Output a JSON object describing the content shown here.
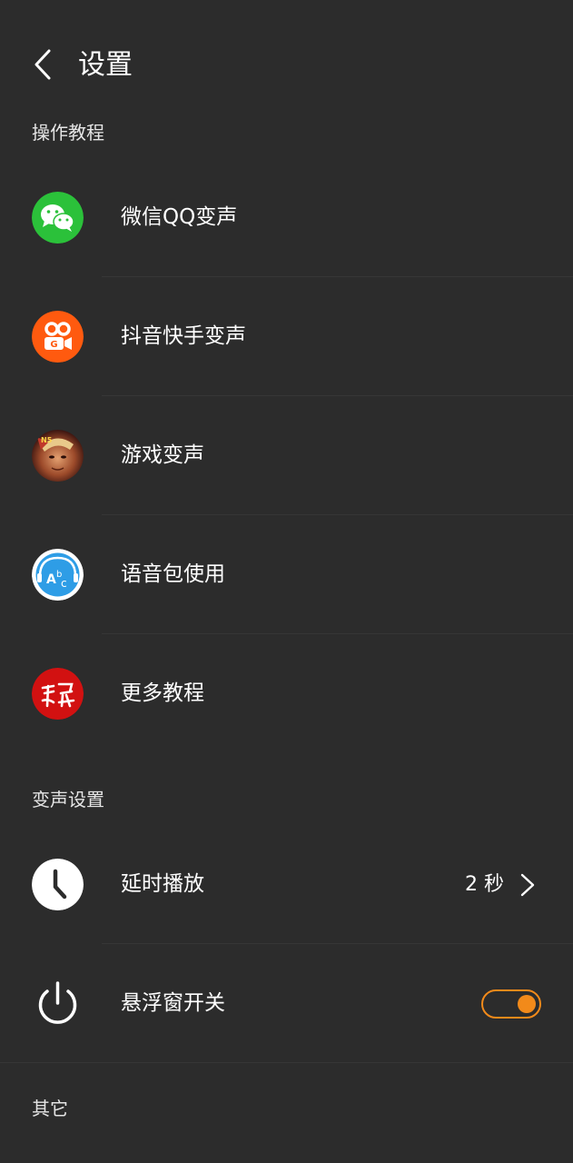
{
  "header": {
    "title": "设置",
    "back_icon": "chevron-left-icon"
  },
  "sections": {
    "tutorials": {
      "label": "操作教程"
    },
    "voice_settings": {
      "label": "变声设置"
    },
    "other": {
      "label": "其它"
    }
  },
  "tutorials": [
    {
      "label": "微信QQ变声",
      "icon": "wechat-icon",
      "icon_color": "#2bc13a"
    },
    {
      "label": "抖音快手变声",
      "icon": "kuaishou-icon",
      "icon_color": "#ff5a0f"
    },
    {
      "label": "游戏变声",
      "icon": "game-avatar-icon",
      "icon_color": "#8a3b2a"
    },
    {
      "label": "语音包使用",
      "icon": "abc-headphones-icon",
      "icon_color": "#2e9de6"
    },
    {
      "label": "更多教程",
      "icon": "study-icon",
      "icon_color": "#d21111"
    }
  ],
  "settings": {
    "delay": {
      "label": "延时播放",
      "value": "2 秒",
      "icon": "clock-icon"
    },
    "floating": {
      "label": "悬浮窗开关",
      "icon": "power-icon",
      "enabled": true
    }
  },
  "colors": {
    "background": "#2c2c2c",
    "accent": "#f28a1a",
    "text": "#ffffff"
  }
}
